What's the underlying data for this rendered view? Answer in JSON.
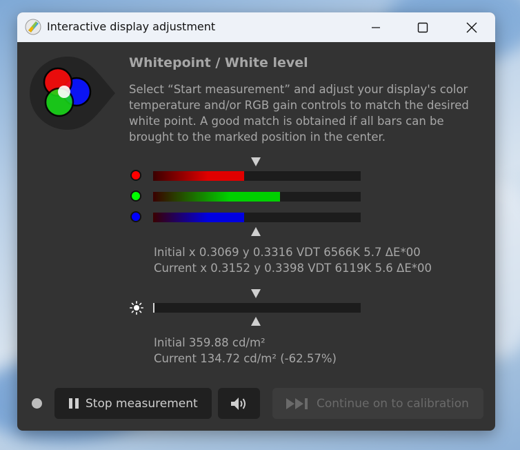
{
  "window": {
    "title": "Interactive display adjustment",
    "minimize_icon": "minimize-icon",
    "maximize_icon": "maximize-icon",
    "close_icon": "close-icon"
  },
  "content": {
    "heading": "Whitepoint / White level",
    "instructions": "Select “Start measurement” and adjust your display's color temperature and/or RGB gain controls to match the desired white point. A good match is obtained if all bars can be brought to the marked position in the center.",
    "rgb_bars": [
      {
        "channel": "red",
        "level": 0.44,
        "color": "#e00000",
        "dot_color": "#ff0000"
      },
      {
        "channel": "green",
        "level": 0.61,
        "color": "#00d000",
        "dot_color": "#00ff00"
      },
      {
        "channel": "blue",
        "level": 0.44,
        "color": "#0000e0",
        "dot_color": "#0000ff"
      }
    ],
    "whitepoint_initial": "Initial x 0.3069 y 0.3316 VDT 6566K 5.7 ΔE*00",
    "whitepoint_current": "Current x 0.3152 y 0.3398 VDT 6119K 5.6 ΔE*00",
    "luminance_bar": {
      "level": 0.005
    },
    "luminance_initial": "Initial 359.88 cd/m²",
    "luminance_current": "Current 134.72 cd/m² (-62.57%)"
  },
  "footer": {
    "stop_label": "Stop measurement",
    "sound_icon": "speaker-icon",
    "continue_label": "Continue on to calibration"
  },
  "colors": {
    "window_bg": "#333333",
    "titlebar_bg": "#eef2f8",
    "text": "#a7a7a7",
    "button_bg": "#202020",
    "disabled_button_bg": "#3c3c3c"
  }
}
